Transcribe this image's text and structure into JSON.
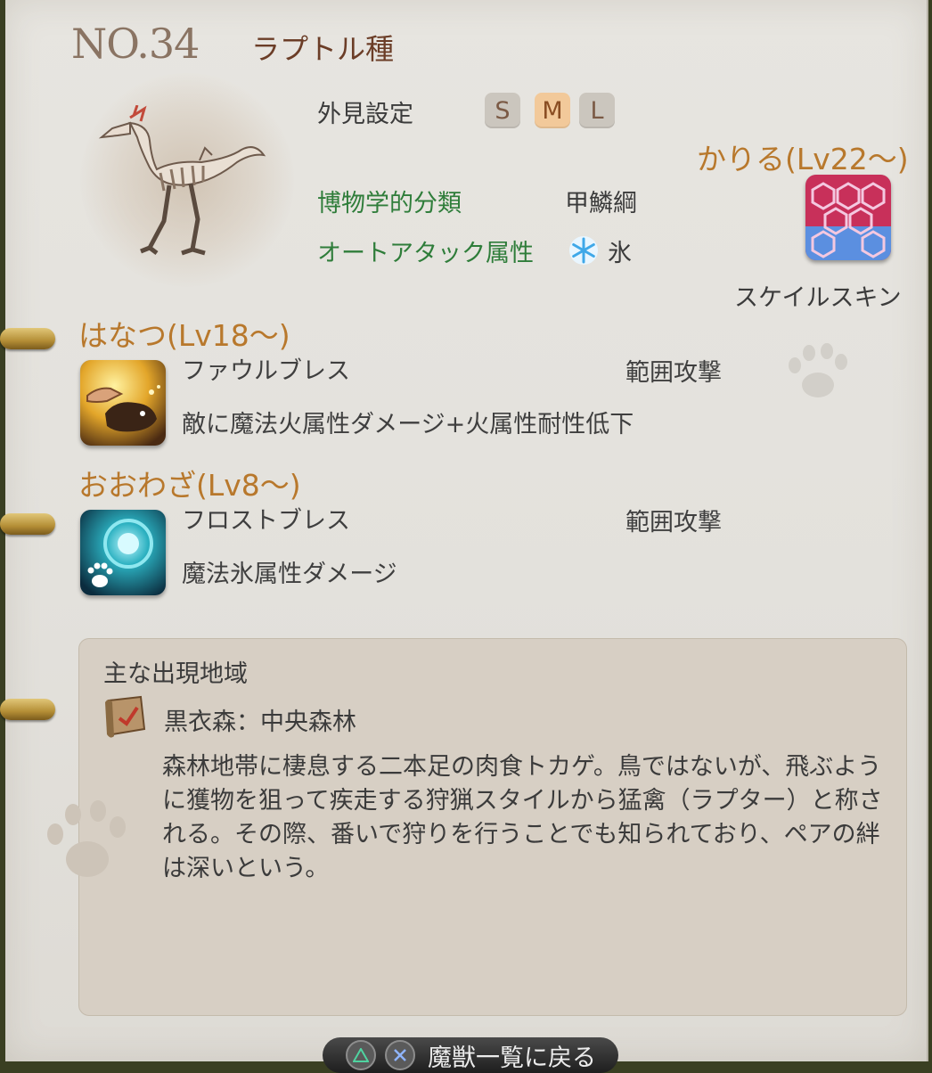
{
  "header": {
    "number": "NO.34",
    "species": "ラプトル種"
  },
  "appearance": {
    "label": "外見設定",
    "sizes": [
      {
        "label": "S",
        "selected": false
      },
      {
        "label": "M",
        "selected": true
      },
      {
        "label": "L",
        "selected": false
      }
    ]
  },
  "info": {
    "classification_label": "博物学的分類",
    "classification_value": "甲鱗綱",
    "autoattack_label": "オートアタック属性",
    "autoattack_value": "氷"
  },
  "karu": {
    "title": "かりる(Lv22～)",
    "skill_name": "スケイルスキン"
  },
  "hanatsu": {
    "title": "はなつ(Lv18～)",
    "skill_name": "ファウルブレス",
    "skill_type": "範囲攻撃",
    "description": "敵に魔法火属性ダメージ+火属性耐性低下"
  },
  "oowaza": {
    "title": "おおわざ(Lv8～)",
    "skill_name": "フロストブレス",
    "skill_type": "範囲攻撃",
    "description": "魔法氷属性ダメージ"
  },
  "region": {
    "title": "主な出現地域",
    "place": "黒衣森：中央森林",
    "description": "森林地帯に棲息する二本足の肉食トカゲ。鳥ではないが、飛ぶように獲物を狙って疾走する狩猟スタイルから猛禽（ラプター）と称される。その際、番いで狩りを行うことでも知られており、ペアの絆は深いという。"
  },
  "footer": {
    "back_label": "魔獣一覧に戻る"
  },
  "colors": {
    "section_title": "#b8782c",
    "green_label": "#2f7d3a",
    "selected_size": "#f2c99a"
  }
}
